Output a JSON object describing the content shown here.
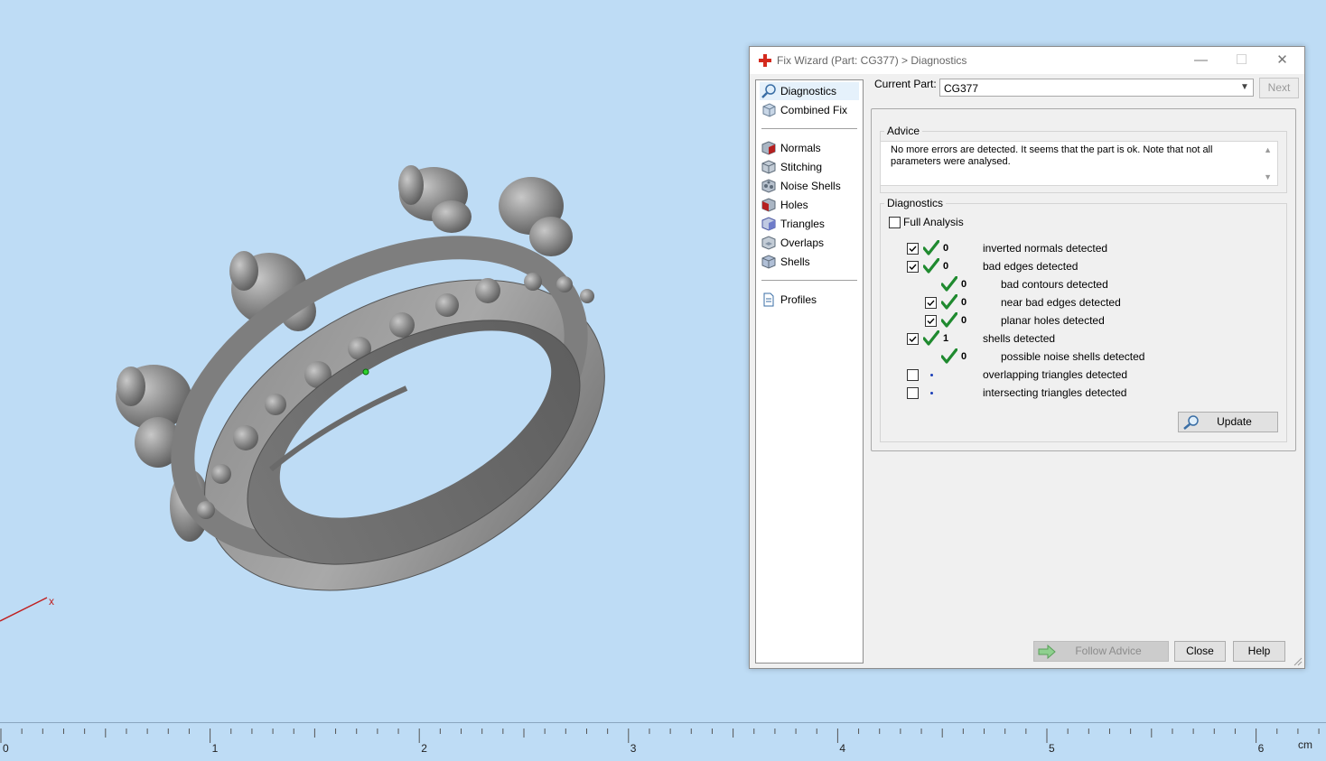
{
  "dialog": {
    "title": "Fix Wizard (Part: CG377) > Diagnostics",
    "window_controls": {
      "minimize": "—",
      "maximize": "☐",
      "close": "✕"
    }
  },
  "nav": {
    "groups": [
      [
        {
          "label": "Diagnostics",
          "icon": "magnifier-icon",
          "selected": true
        },
        {
          "label": "Combined Fix",
          "icon": "combined-fix-icon",
          "selected": false
        }
      ],
      [
        {
          "label": "Normals",
          "icon": "normals-cube-icon"
        },
        {
          "label": "Stitching",
          "icon": "stitching-cube-icon"
        },
        {
          "label": "Noise Shells",
          "icon": "noise-shells-cube-icon"
        },
        {
          "label": "Holes",
          "icon": "holes-cube-icon"
        },
        {
          "label": "Triangles",
          "icon": "triangles-cube-icon"
        },
        {
          "label": "Overlaps",
          "icon": "overlaps-cube-icon"
        },
        {
          "label": "Shells",
          "icon": "shells-cube-icon"
        }
      ],
      [
        {
          "label": "Profiles",
          "icon": "profiles-document-icon"
        }
      ]
    ]
  },
  "current_part": {
    "label": "Current Part:",
    "value": "CG377"
  },
  "next_button": "Next",
  "advice": {
    "title": "Advice",
    "text": "No more errors are detected. It seems that the part is ok. Note that not all parameters were analysed."
  },
  "diagnostics": {
    "title": "Diagnostics",
    "full_analysis": {
      "label": "Full Analysis",
      "checked": false
    },
    "rows": [
      {
        "label": "inverted normals detected",
        "count": "0",
        "checkbox": true,
        "checked": true,
        "status": "ok",
        "indent": 0
      },
      {
        "label": "bad edges detected",
        "count": "0",
        "checkbox": true,
        "checked": true,
        "status": "ok",
        "indent": 0
      },
      {
        "label": "bad contours detected",
        "count": "0",
        "checkbox": false,
        "checked": false,
        "status": "ok",
        "indent": 1
      },
      {
        "label": "near bad edges detected",
        "count": "0",
        "checkbox": true,
        "checked": true,
        "status": "ok",
        "indent": 1
      },
      {
        "label": "planar holes detected",
        "count": "0",
        "checkbox": true,
        "checked": true,
        "status": "ok",
        "indent": 1
      },
      {
        "label": "shells detected",
        "count": "1",
        "checkbox": true,
        "checked": true,
        "status": "ok",
        "indent": 0
      },
      {
        "label": "possible noise shells detected",
        "count": "0",
        "checkbox": false,
        "checked": false,
        "status": "ok",
        "indent": 1
      },
      {
        "label": "overlapping triangles detected",
        "count": "",
        "checkbox": true,
        "checked": false,
        "status": "not-analysed",
        "indent": 0
      },
      {
        "label": "intersecting triangles detected",
        "count": "",
        "checkbox": true,
        "checked": false,
        "status": "not-analysed",
        "indent": 0
      }
    ],
    "update_button": "Update"
  },
  "footer": {
    "follow_advice": "Follow Advice",
    "close": "Close",
    "help": "Help"
  },
  "viewport": {
    "axis_label": "x",
    "ruler": {
      "labels": [
        "0",
        "1",
        "2",
        "3",
        "4",
        "5",
        "6"
      ],
      "unit": "cm"
    }
  },
  "colors": {
    "background": "#bedcf5",
    "check_green": "#1f8a2f",
    "title_icon_red": "#d42a1e",
    "axis_red": "#c02020"
  }
}
